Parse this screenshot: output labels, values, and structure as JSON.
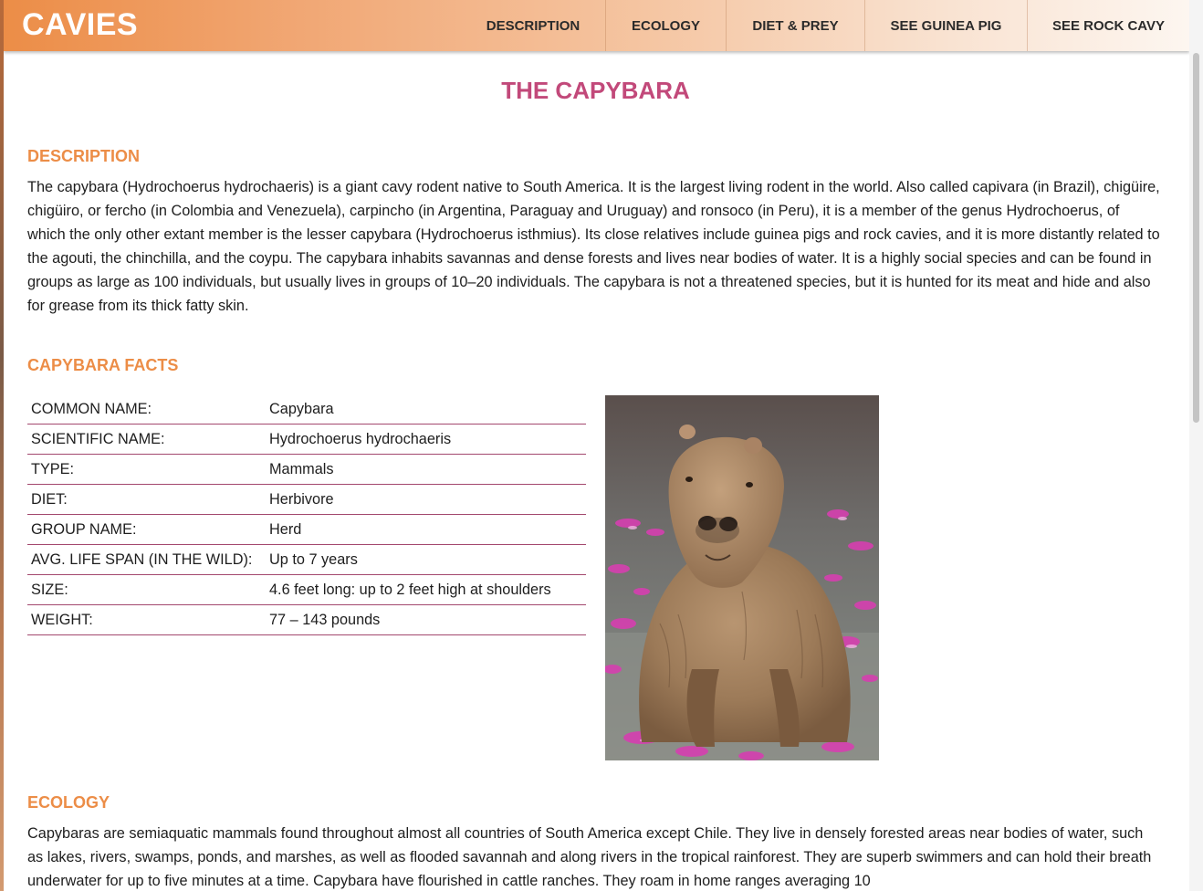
{
  "header": {
    "brand": "CAVIES",
    "nav": [
      "DESCRIPTION",
      "ECOLOGY",
      "DIET & PREY",
      "SEE GUINEA PIG",
      "SEE ROCK CAVY"
    ]
  },
  "main": {
    "title": "THE CAPYBARA",
    "description": {
      "heading": "DESCRIPTION",
      "text": "The capybara (Hydrochoerus hydrochaeris) is a giant cavy rodent native to South America. It is the largest living rodent in the world. Also called capivara (in Brazil), chigüire, chigüiro, or fercho (in Colombia and Venezuela), carpincho (in Argentina, Paraguay and Uruguay) and ronsoco (in Peru), it is a member of the genus Hydrochoerus, of which the only other extant member is the lesser capybara (Hydrochoerus isthmius). Its close relatives include guinea pigs and rock cavies, and it is more distantly related to the agouti, the chinchilla, and the coypu. The capybara inhabits savannas and dense forests and lives near bodies of water. It is a highly social species and can be found in groups as large as 100 individuals, but usually lives in groups of 10–20 individuals. The capybara is not a threatened species, but it is hunted for its meat and hide and also for grease from its thick fatty skin."
    },
    "facts": {
      "heading": "CAPYBARA FACTS",
      "rows": [
        {
          "key": "COMMON NAME:",
          "value": "Capybara"
        },
        {
          "key": "SCIENTIFIC NAME:",
          "value": "Hydrochoerus hydrochaeris"
        },
        {
          "key": "TYPE:",
          "value": "Mammals"
        },
        {
          "key": "DIET:",
          "value": "Herbivore"
        },
        {
          "key": "GROUP NAME:",
          "value": "Herd"
        },
        {
          "key": "AVG. LIFE SPAN (IN THE WILD):",
          "value": "Up to 7 years"
        },
        {
          "key": "SIZE:",
          "value": "4.6 feet long: up to 2 feet high at shoulders"
        },
        {
          "key": "WEIGHT:",
          "value": "77 – 143 pounds"
        }
      ]
    },
    "ecology": {
      "heading": "ECOLOGY",
      "text": "Capybaras are semiaquatic mammals found throughout almost all countries of South America except Chile. They live in densely forested areas near bodies of water, such as lakes, rivers, swamps, ponds, and marshes, as well as flooded savannah and along rivers in the tropical rainforest. They are superb swimmers and can hold their breath underwater for up to five minutes at a time. Capybara have flourished in cattle ranches. They roam in home ranges averaging 10"
    }
  },
  "colors": {
    "accent_orange": "#ec8d47",
    "title_pink": "#c2497a",
    "table_rule": "#a3486e"
  }
}
